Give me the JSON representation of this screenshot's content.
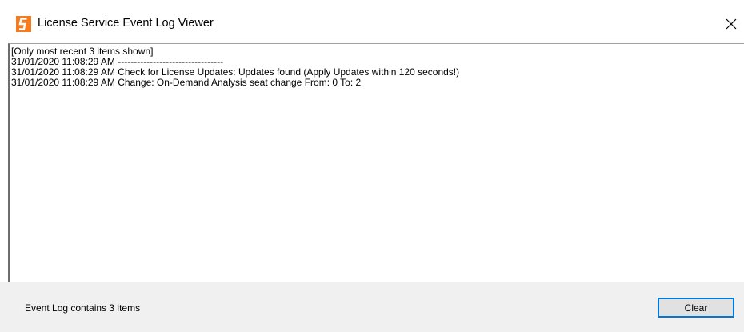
{
  "window": {
    "title": "License Service Event Log Viewer",
    "icon": "app-logo-icon",
    "accent_color": "#f47b20"
  },
  "log": {
    "lines": [
      "[Only most recent 3 items shown]",
      "31/01/2020 11:08:29 AM ---------------------------------",
      "31/01/2020 11:08:29 AM Check for License Updates: Updates found (Apply Updates within 120 seconds!)",
      "31/01/2020 11:08:29 AM Change: On-Demand Analysis seat change From: 0 To: 2"
    ]
  },
  "footer": {
    "status": "Event Log contains 3 items",
    "clear_label": "Clear"
  }
}
